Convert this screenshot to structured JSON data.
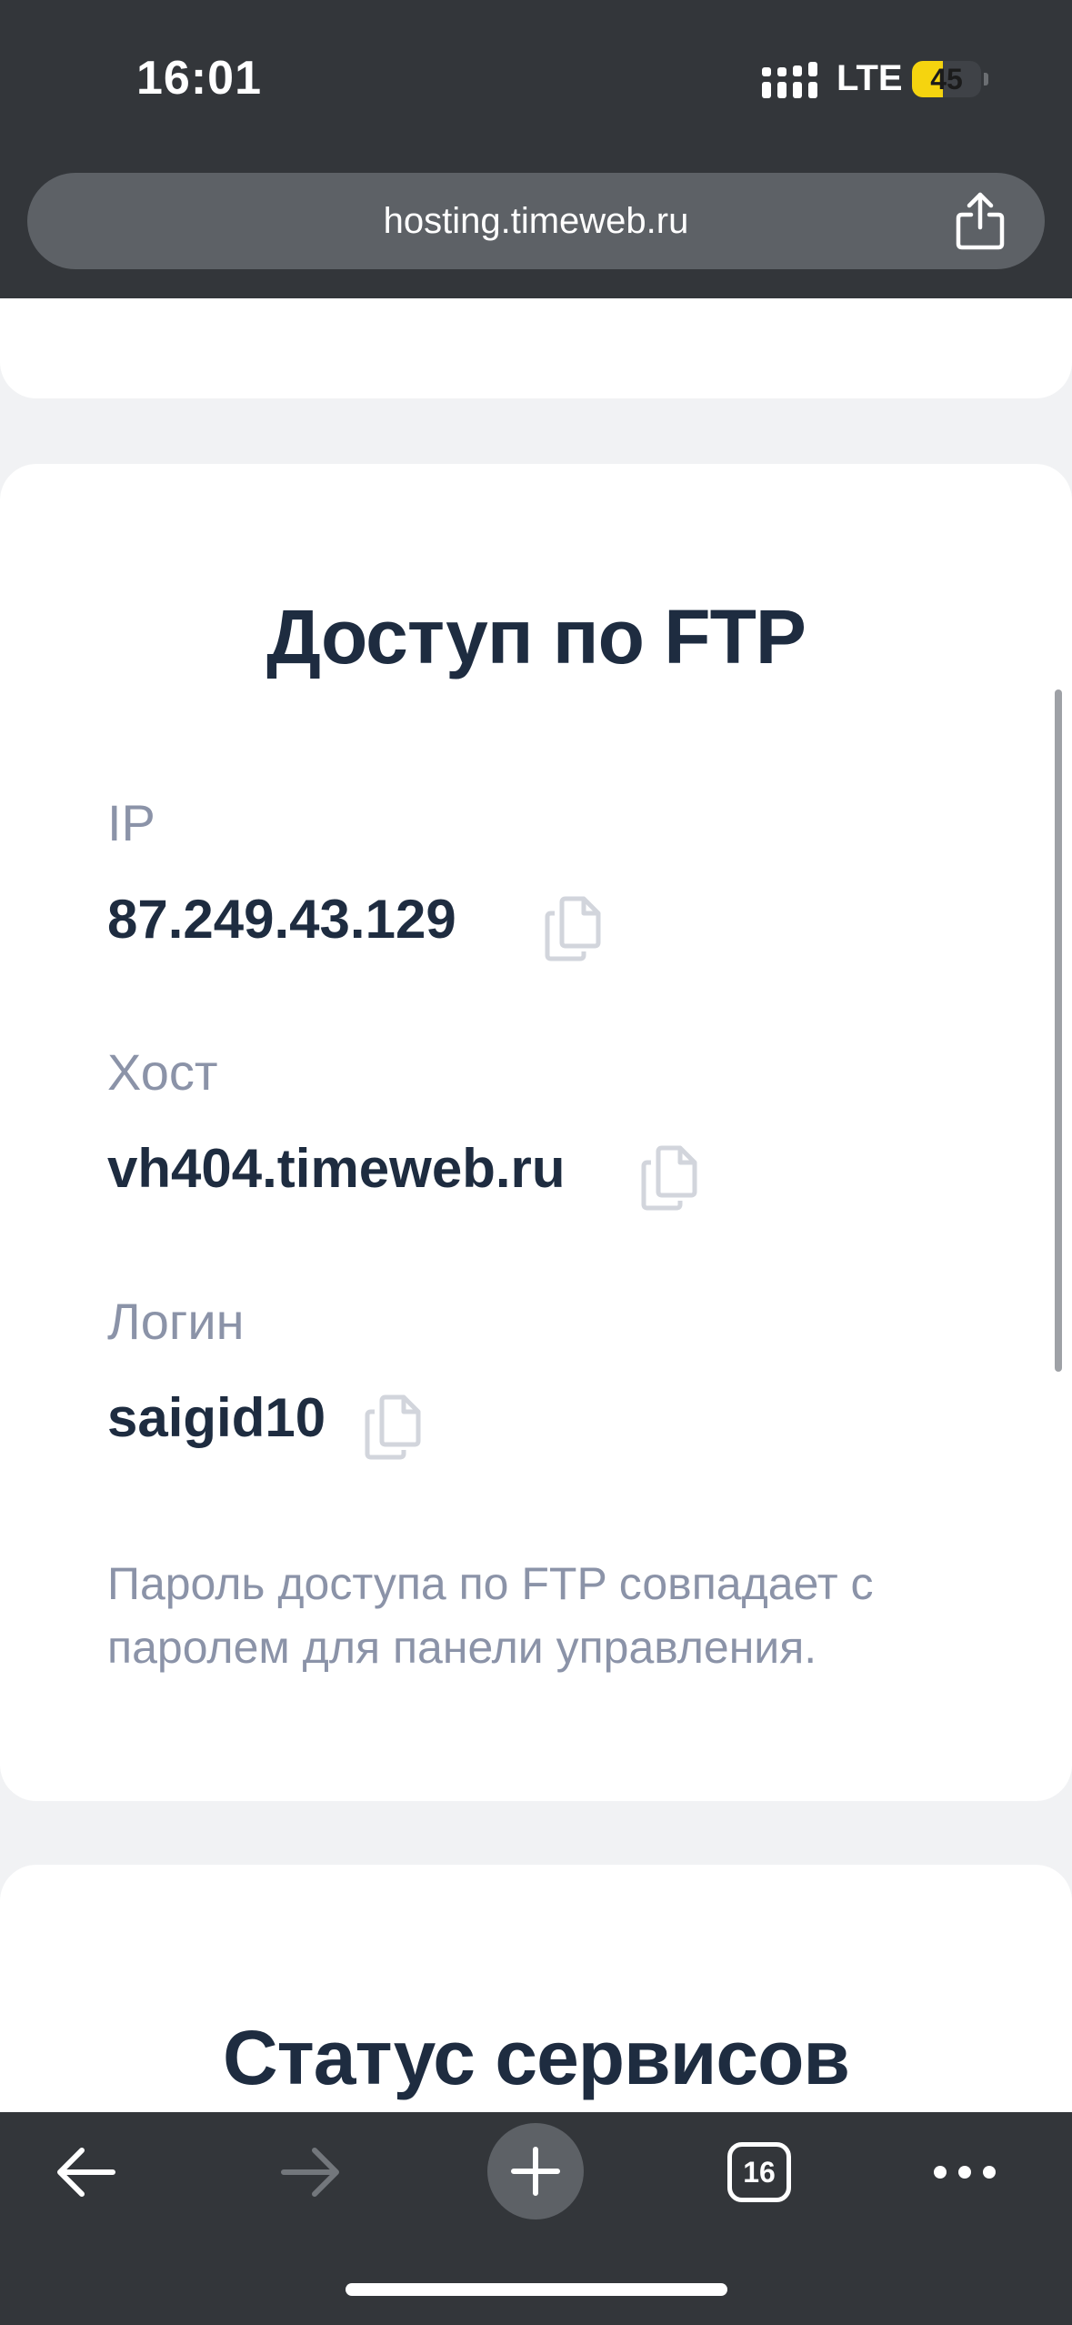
{
  "status_bar": {
    "time": "16:01",
    "network": "LTE",
    "battery_level": "45",
    "battery_percent": 45,
    "icons": [
      "signal-icon",
      "battery-icon"
    ]
  },
  "browser": {
    "url": "hosting.timeweb.ru",
    "share_icon": "share-icon",
    "toolbar": {
      "back_icon": "arrow-left-icon",
      "forward_icon": "arrow-right-icon",
      "new_tab_icon": "plus-icon",
      "tab_count": "16",
      "menu_icon": "more-dots-icon"
    }
  },
  "ftp_card": {
    "title": "Доступ по FTP",
    "fields": [
      {
        "label": "IP",
        "value": "87.249.43.129"
      },
      {
        "label": "Хост",
        "value": "vh404.timeweb.ru"
      },
      {
        "label": "Логин",
        "value": "saigid10"
      }
    ],
    "copy_icon": "copy-icon",
    "note": "Пароль доступа по FTP совпадает с паролем для панели управления."
  },
  "status_card": {
    "title": "Статус сервисов"
  },
  "colors": {
    "chrome_bg": "#33363a",
    "url_bar_bg": "#5d6166",
    "page_bg": "#f1f2f4",
    "title_color": "#1e2c40",
    "muted_text": "#8b93a8",
    "battery_accent": "#f5d40f"
  }
}
